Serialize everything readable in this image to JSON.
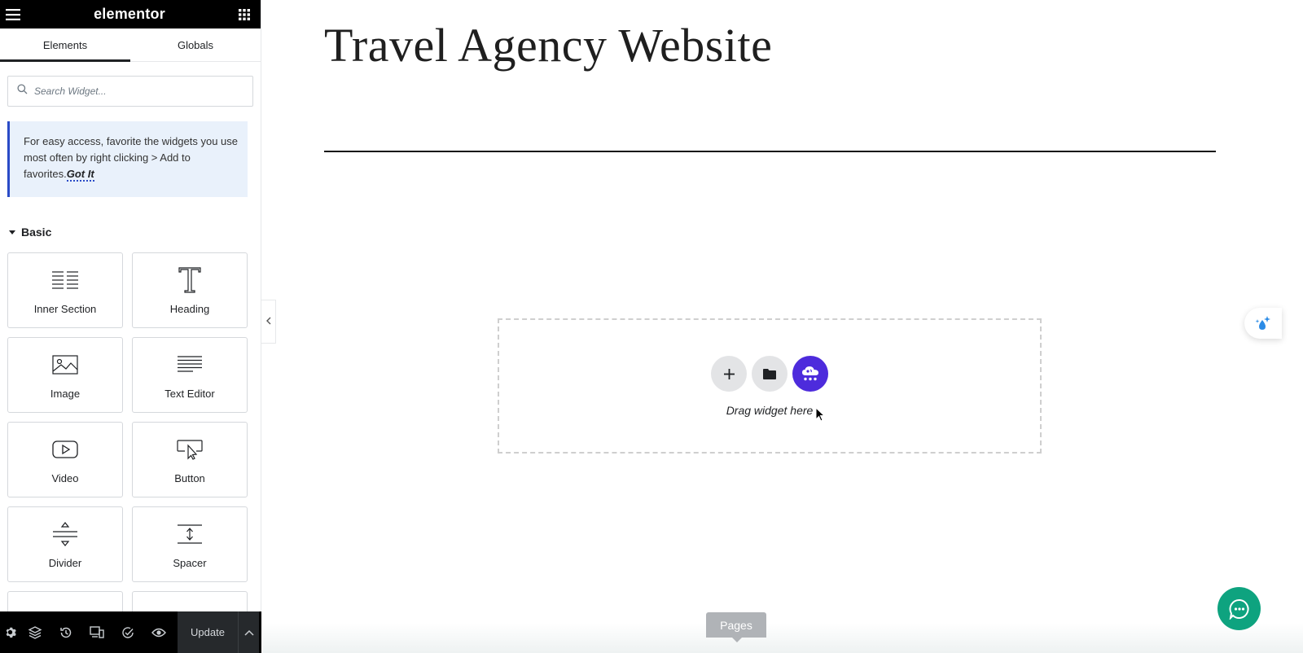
{
  "topbar": {
    "brand": "elementor",
    "menu_icon": "hamburger-icon",
    "grid_icon": "apps-grid-icon"
  },
  "tabs": [
    {
      "label": "Elements",
      "active": true
    },
    {
      "label": "Globals",
      "active": false
    }
  ],
  "search": {
    "placeholder": "Search Widget...",
    "value": ""
  },
  "notice": {
    "text": "For easy access, favorite the widgets you use most often by right clicking > Add to favorites.",
    "action": "Got It"
  },
  "category": {
    "label": "Basic"
  },
  "widgets": [
    {
      "label": "Inner Section",
      "icon": "columns-icon"
    },
    {
      "label": "Heading",
      "icon": "heading-icon"
    },
    {
      "label": "Image",
      "icon": "image-icon"
    },
    {
      "label": "Text Editor",
      "icon": "text-editor-icon"
    },
    {
      "label": "Video",
      "icon": "video-icon"
    },
    {
      "label": "Button",
      "icon": "button-icon"
    },
    {
      "label": "Divider",
      "icon": "divider-icon"
    },
    {
      "label": "Spacer",
      "icon": "spacer-icon"
    }
  ],
  "bottombar": {
    "update_label": "Update",
    "icons": [
      "settings-icon",
      "navigator-icon",
      "history-icon",
      "responsive-icon",
      "checklist-icon",
      "preview-icon"
    ]
  },
  "canvas": {
    "title": "Travel Agency Website",
    "dropzone_text": "Drag widget here",
    "pages_label": "Pages"
  },
  "colors": {
    "accent": "#2a4bc7",
    "ai_button": "#4d2bdc",
    "chat_button": "#0ea37f",
    "topbar": "#000000"
  }
}
